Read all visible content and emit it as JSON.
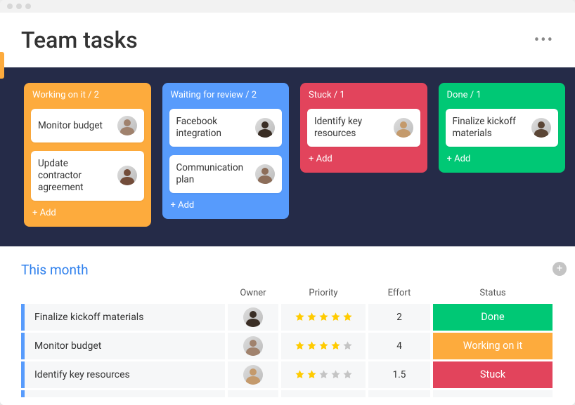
{
  "header": {
    "title": "Team tasks"
  },
  "board": {
    "columns": [
      {
        "id": "working",
        "class": "col-working",
        "label": "Working on it / 2",
        "cards": [
          {
            "label": "Monitor budget",
            "avatar": "a1"
          },
          {
            "label": "Update contractor agreement",
            "avatar": "a6"
          }
        ],
        "add": "+ Add"
      },
      {
        "id": "waiting",
        "class": "col-waiting",
        "label": "Waiting for review / 2",
        "cards": [
          {
            "label": "Facebook integration",
            "avatar": "a3"
          },
          {
            "label": "Communication plan",
            "avatar": "a5"
          }
        ],
        "add": "+ Add"
      },
      {
        "id": "stuck",
        "class": "col-stuck",
        "label": "Stuck / 1",
        "cards": [
          {
            "label": "Identify key resources",
            "avatar": "a4"
          }
        ],
        "add": "+ Add"
      },
      {
        "id": "done",
        "class": "col-done",
        "label": "Done / 1",
        "cards": [
          {
            "label": "Finalize kickoff materials",
            "avatar": "a2"
          }
        ],
        "add": "+ Add"
      }
    ]
  },
  "table": {
    "title": "This month",
    "headers": {
      "owner": "Owner",
      "priority": "Priority",
      "effort": "Effort",
      "status": "Status"
    },
    "rows": [
      {
        "name": "Finalize kickoff materials",
        "avatar": "a3",
        "stars": 5,
        "effort": "2",
        "status": "Done",
        "status_class": "st-done"
      },
      {
        "name": "Monitor budget",
        "avatar": "a1",
        "stars": 4,
        "effort": "4",
        "status": "Working on it",
        "status_class": "st-working"
      },
      {
        "name": "Identify key resources",
        "avatar": "a4",
        "stars": 2,
        "effort": "1.5",
        "status": "Stuck",
        "status_class": "st-stuck"
      }
    ]
  }
}
